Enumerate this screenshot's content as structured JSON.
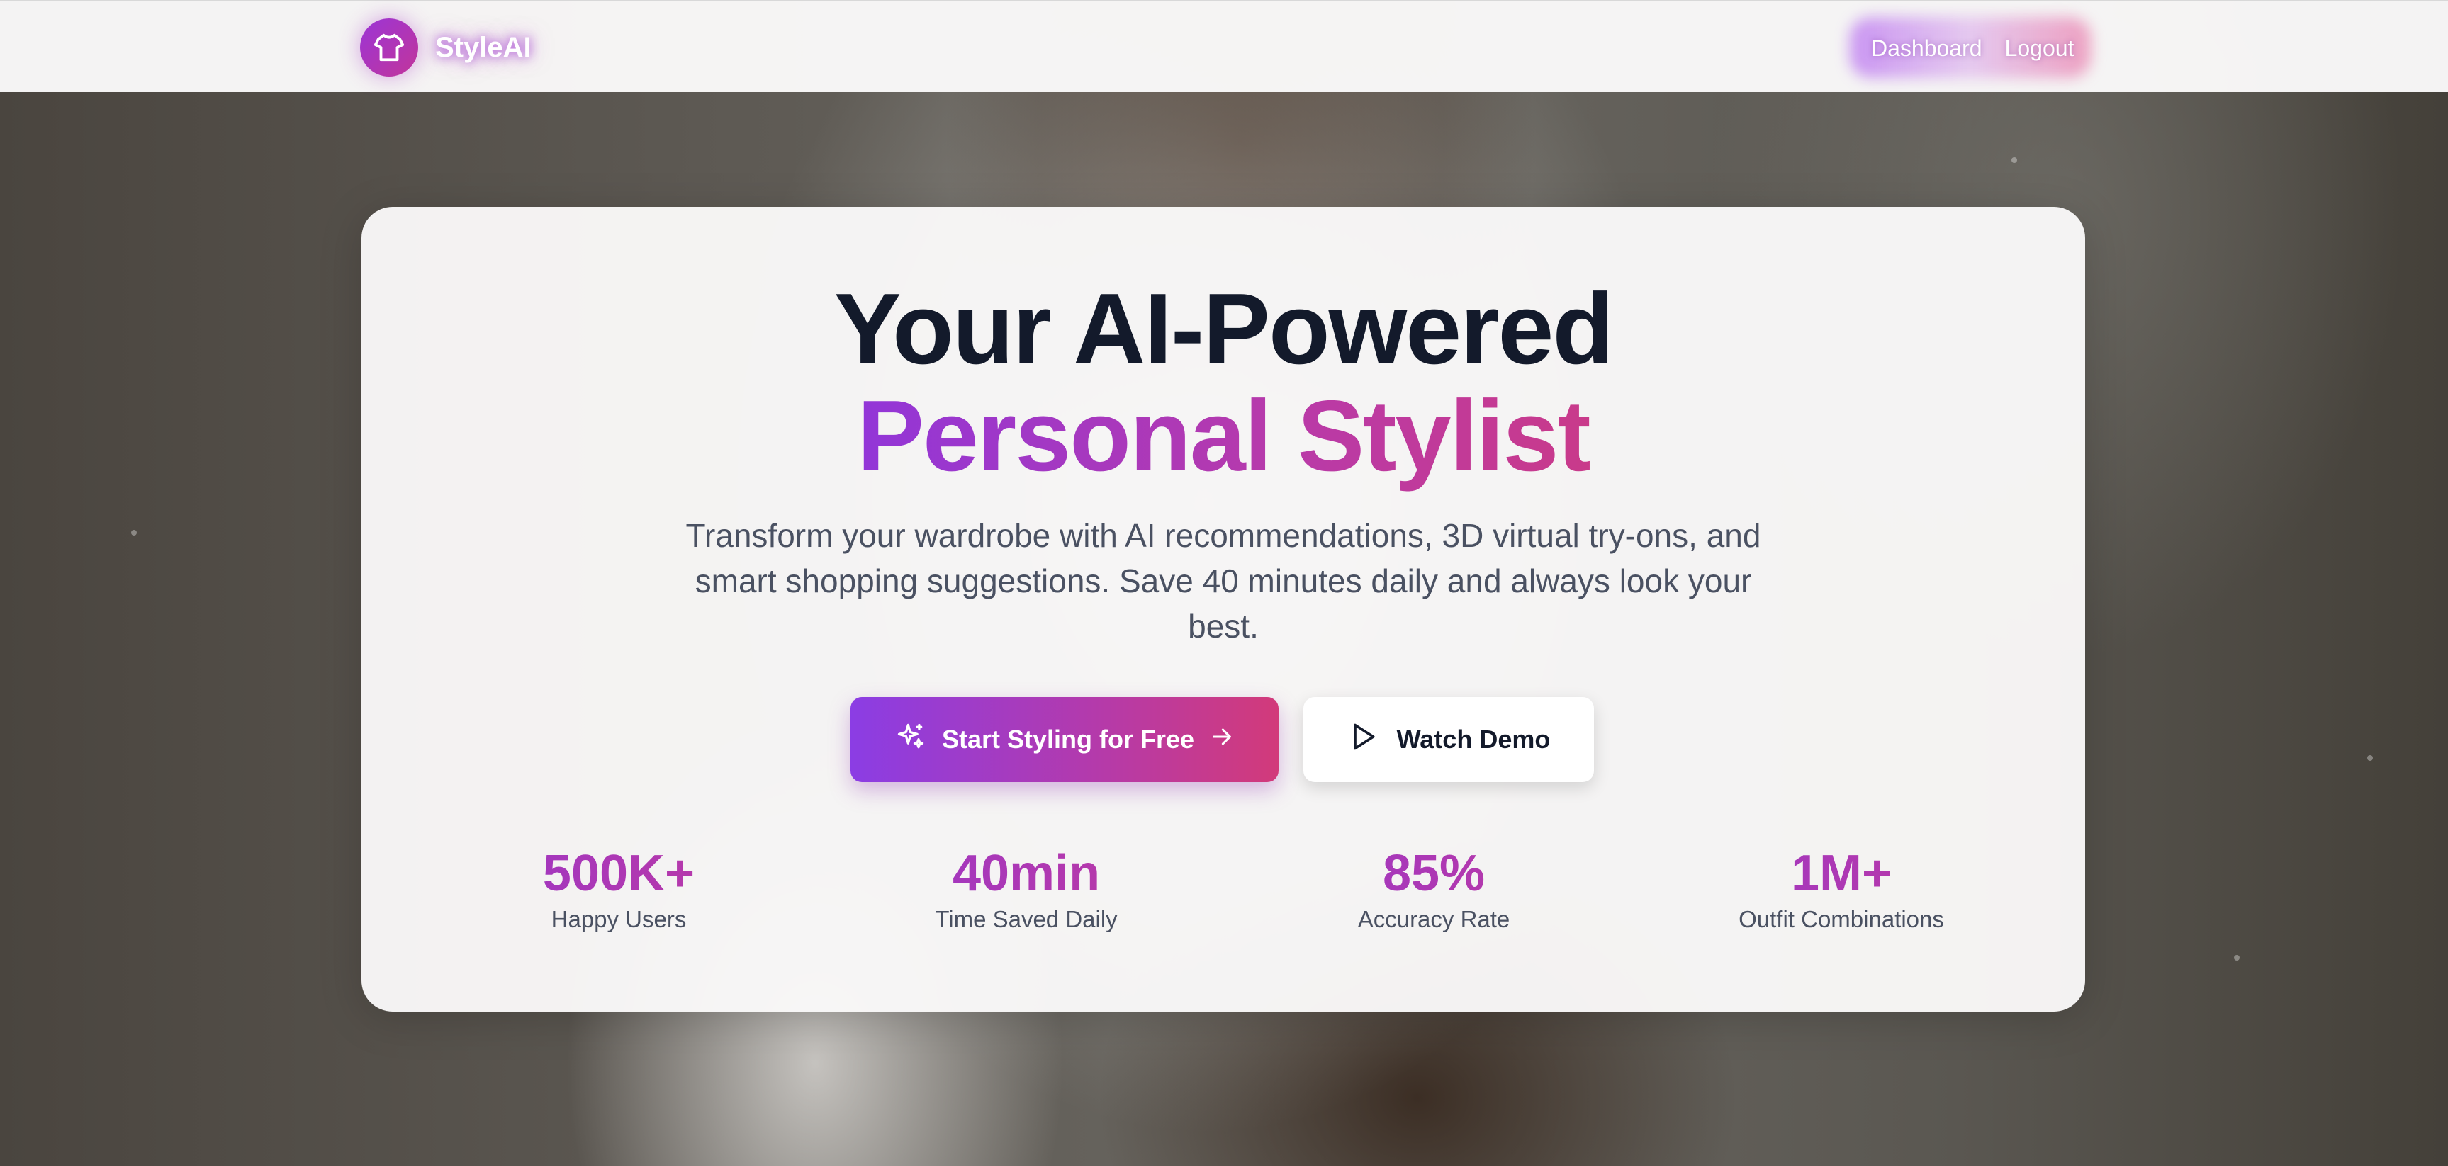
{
  "brand": {
    "name": "StyleAI",
    "logo_icon": "shirt-icon"
  },
  "nav": {
    "links": [
      "Dashboard",
      "Logout"
    ]
  },
  "hero": {
    "title_line1": "Your AI-Powered",
    "title_line2": "Personal Stylist",
    "subtitle": "Transform your wardrobe with AI recommendations, 3D virtual try-ons, and smart shopping suggestions. Save 40 minutes daily and always look your best.",
    "primary_button": {
      "label": "Start Styling for Free",
      "leading_icon": "sparkles-icon",
      "trailing_icon": "arrow-right-icon"
    },
    "secondary_button": {
      "label": "Watch Demo",
      "icon": "play-icon"
    }
  },
  "stats": [
    {
      "value": "500K+",
      "label": "Happy Users"
    },
    {
      "value": "40min",
      "label": "Time Saved Daily"
    },
    {
      "value": "85%",
      "label": "Accuracy Rate"
    },
    {
      "value": "1M+",
      "label": "Outfit Combinations"
    }
  ],
  "colors": {
    "accent_start": "#8b3de4",
    "accent_end": "#d23a7a",
    "heading": "#131a2b",
    "body_text": "#4a5162"
  }
}
